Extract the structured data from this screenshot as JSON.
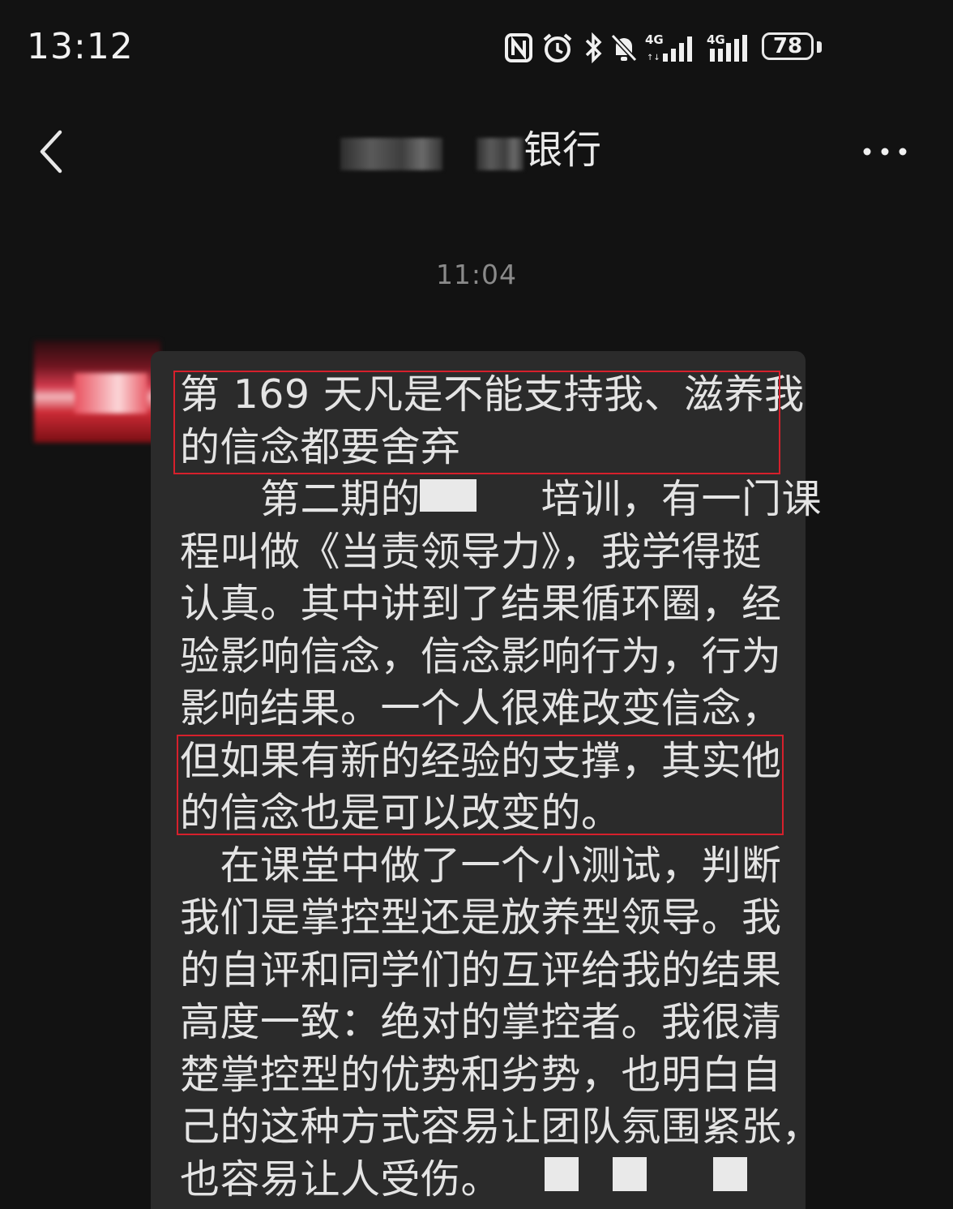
{
  "status_bar": {
    "time": "13:12",
    "icons": [
      "nfc-icon",
      "alarm-icon",
      "bluetooth-icon",
      "mute-bell-icon",
      "signal-4g-sim1-icon",
      "signal-4g-sim2-icon"
    ],
    "network_labels": [
      "4G",
      "4G"
    ],
    "battery_level": "78"
  },
  "header": {
    "back_icon": "chevron-left-icon",
    "title_visible": "银行",
    "title_redacted": true,
    "more_icon": "more-dots-icon"
  },
  "chat": {
    "timestamp": "11:04",
    "message": {
      "lines": [
        "第 169 天凡是不能支持我、滋养我",
        "的信念都要舍弃",
        "　　第二期的　　　培训，有一门课",
        "程叫做《当责领导力》，我学得挺",
        "认真。其中讲到了结果循环圈，经",
        "验影响信念，信念影响行为，行为",
        "影响结果。一个人很难改变信念，",
        "但如果有新的经验的支撑，其实他",
        "的信念也是可以改变的。",
        "　在课堂中做了一个小测试，判断",
        "我们是掌控型还是放养型领导。我",
        "的自评和同学们的互评给我的结果",
        "高度一致：绝对的掌控者。我很清",
        "楚掌控型的优势和劣势，也明白自",
        "己的这种方式容易让团队氛围紧张，",
        "也容易让人受伤。"
      ],
      "highlight_color": "#d6202c"
    }
  },
  "colors": {
    "background": "#121212",
    "bubble": "#2b2b2b",
    "text": "#e4e4e4",
    "timestamp": "#8a8a8a"
  }
}
